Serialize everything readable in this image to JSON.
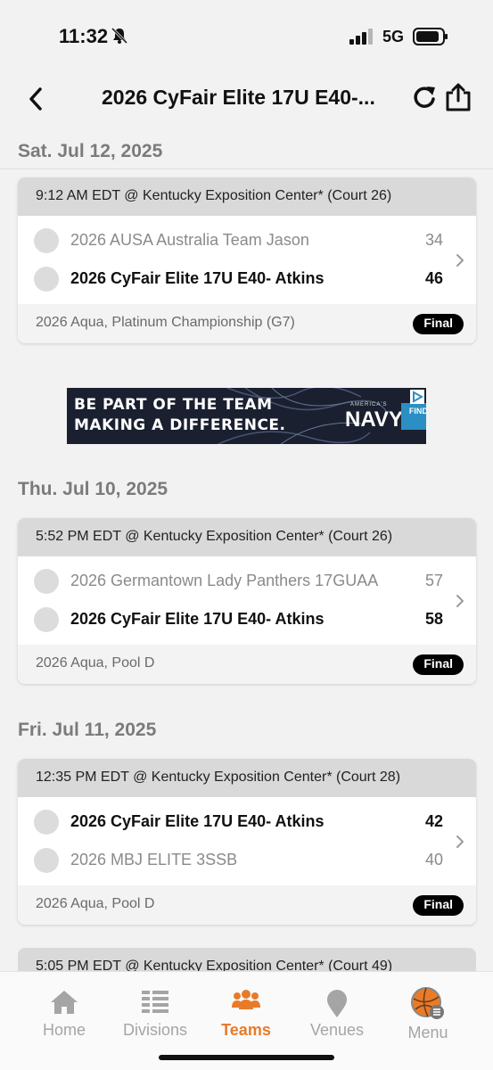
{
  "status_bar": {
    "time": "11:32",
    "network": "5G"
  },
  "header": {
    "title": "2026 CyFair Elite 17U E40-..."
  },
  "sections": [
    {
      "date": "Sat. Jul 12, 2025",
      "games": [
        {
          "time_location": "9:12 AM EDT @ Kentucky Exposition Center* (Court 26)",
          "teams": [
            {
              "name": "2026 AUSA Australia Team Jason",
              "score": "34"
            },
            {
              "name": "2026 CyFair Elite 17U E40- Atkins",
              "score": "46"
            }
          ],
          "division": "2026 Aqua, Platinum Championship (G7)",
          "status": "Final"
        }
      ]
    },
    {
      "date": "Thu. Jul 10, 2025",
      "games": [
        {
          "time_location": "5:52 PM EDT @ Kentucky Exposition Center* (Court 26)",
          "teams": [
            {
              "name": "2026 Germantown Lady Panthers 17GUAA",
              "score": "57"
            },
            {
              "name": "2026 CyFair Elite 17U E40- Atkins",
              "score": "58"
            }
          ],
          "division": "2026 Aqua, Pool D",
          "status": "Final"
        }
      ]
    },
    {
      "date": "Fri. Jul 11, 2025",
      "games": [
        {
          "time_location": "12:35 PM EDT @ Kentucky Exposition Center* (Court 28)",
          "teams": [
            {
              "name": "2026 CyFair Elite 17U E40- Atkins",
              "score": "42"
            },
            {
              "name": "2026 MBJ ELITE 3SSB",
              "score": "40"
            }
          ],
          "division": "2026 Aqua, Pool D",
          "status": "Final"
        },
        {
          "time_location": "5:05 PM EDT @ Kentucky Exposition Center* (Court 49)"
        }
      ]
    }
  ],
  "ad": {
    "line1": "BE PART OF THE TEAM",
    "line2": "MAKING A DIFFERENCE.",
    "brand_small": "AMERICA'S",
    "brand": "NAVY",
    "cta": "FIND YOUR TEAM"
  },
  "tabs": [
    {
      "label": "Home",
      "icon": "home-icon"
    },
    {
      "label": "Divisions",
      "icon": "divisions-icon"
    },
    {
      "label": "Teams",
      "icon": "teams-icon"
    },
    {
      "label": "Venues",
      "icon": "venues-icon"
    },
    {
      "label": "Menu",
      "icon": "menu-icon"
    }
  ],
  "colors": {
    "accent": "#e87b2a",
    "badge": "#000000",
    "card_header": "#d9d9d9"
  }
}
